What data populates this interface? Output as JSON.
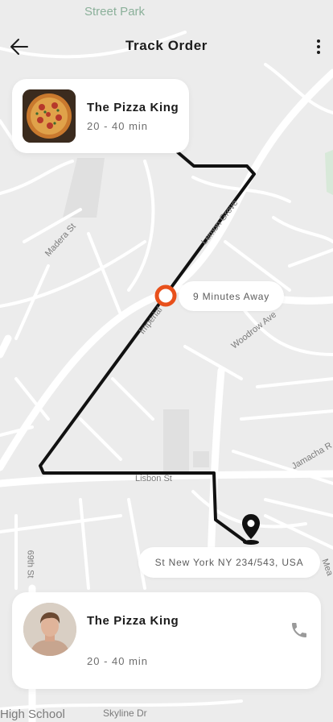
{
  "header": {
    "title": "Track Order",
    "back_icon": "arrow-left-icon",
    "menu_icon": "more-vertical-icon"
  },
  "map": {
    "street_labels": {
      "top_park": "Street Park",
      "madera": "Madera St",
      "lemon_grove": "Lemon Grove",
      "imperial": "Imperial",
      "woodrow": "Woodrow Ave",
      "jamacha": "Jamacha R",
      "lisbon": "Lisbon St",
      "sixty_ninth": "69th St",
      "mea": "Mea",
      "high_school": "High School",
      "skyline": "Skyline Dr"
    },
    "route_color": "#111111",
    "courier_marker_color": "#e8501b"
  },
  "restaurant": {
    "name": "The Pizza King",
    "time": "20 - 40 min"
  },
  "eta": {
    "label": "9 Minutes Away"
  },
  "destination": {
    "address": "St New York NY 234/543, USA",
    "icon": "location-pin-icon"
  },
  "courier": {
    "name": "The Pizza King",
    "time": "20 - 40 min",
    "call_icon": "phone-icon"
  }
}
